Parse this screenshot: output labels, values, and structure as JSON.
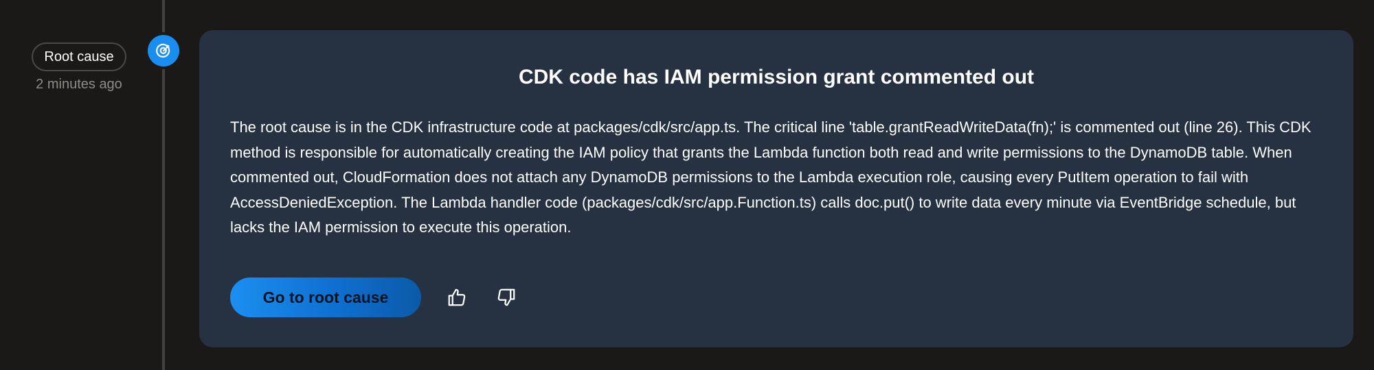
{
  "timeline": {
    "badge_label": "Root cause",
    "timestamp": "2 minutes ago",
    "node_icon": "root-cause-target-icon"
  },
  "card": {
    "title": "CDK code has IAM permission grant commented out",
    "body": "The root cause is in the CDK infrastructure code at packages/cdk/src/app.ts. The critical line 'table.grantReadWriteData(fn);' is commented out (line 26). This CDK method is responsible for automatically creating the IAM policy that grants the Lambda function both read and write permissions to the DynamoDB table. When commented out, CloudFormation does not attach any DynamoDB permissions to the Lambda execution role, causing every PutItem operation to fail with AccessDeniedException. The Lambda handler code (packages/cdk/src/app.Function.ts) calls doc.put() to write data every minute via EventBridge schedule, but lacks the IAM permission to execute this operation.",
    "primary_button": "Go to root cause",
    "feedback": {
      "thumbs_up_icon": "thumbs-up-icon",
      "thumbs_down_icon": "thumbs-down-icon"
    }
  },
  "colors": {
    "background": "#1b1917",
    "card": "#263241",
    "accent": "#1a8ef0",
    "muted_text": "#8e8c89"
  }
}
